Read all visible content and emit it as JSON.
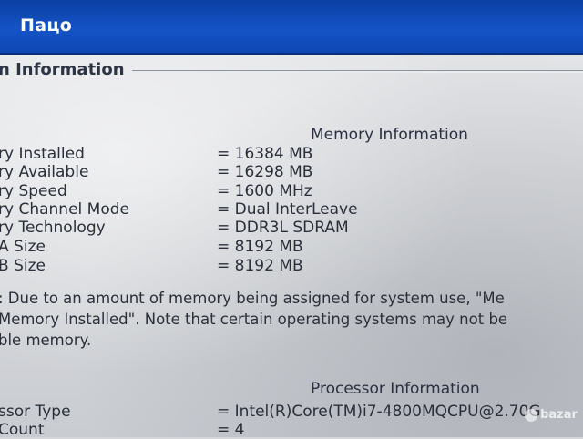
{
  "watermark": {
    "top": "Пацо",
    "bottom_right": "bazar"
  },
  "section_title": "n Information",
  "memory": {
    "title": "Memory Information",
    "rows": [
      {
        "label": "ry Installed",
        "value": "= 16384 MB"
      },
      {
        "label": "ry Available",
        "value": "= 16298 MB"
      },
      {
        "label": "ry Speed",
        "value": "= 1600 MHz"
      },
      {
        "label": "ry Channel Mode",
        "value": "= Dual InterLeave"
      },
      {
        "label": "ry Technology",
        "value": "= DDR3L SDRAM"
      },
      {
        "label": "A Size",
        "value": "= 8192 MB"
      },
      {
        "label": "B Size",
        "value": "= 8192 MB"
      }
    ],
    "note_lines": [
      ": Due to an amount of memory being assigned for system use, \"Me",
      "Memory Installed\". Note that certain operating systems may not be",
      "ble memory."
    ]
  },
  "processor": {
    "title": "Processor Information",
    "rows": [
      {
        "label": "ssor Type",
        "value": "= Intel(R)Core(TM)i7-4800MQCPU@2.70G"
      },
      {
        "label": "Count",
        "value": "= 4"
      }
    ]
  }
}
